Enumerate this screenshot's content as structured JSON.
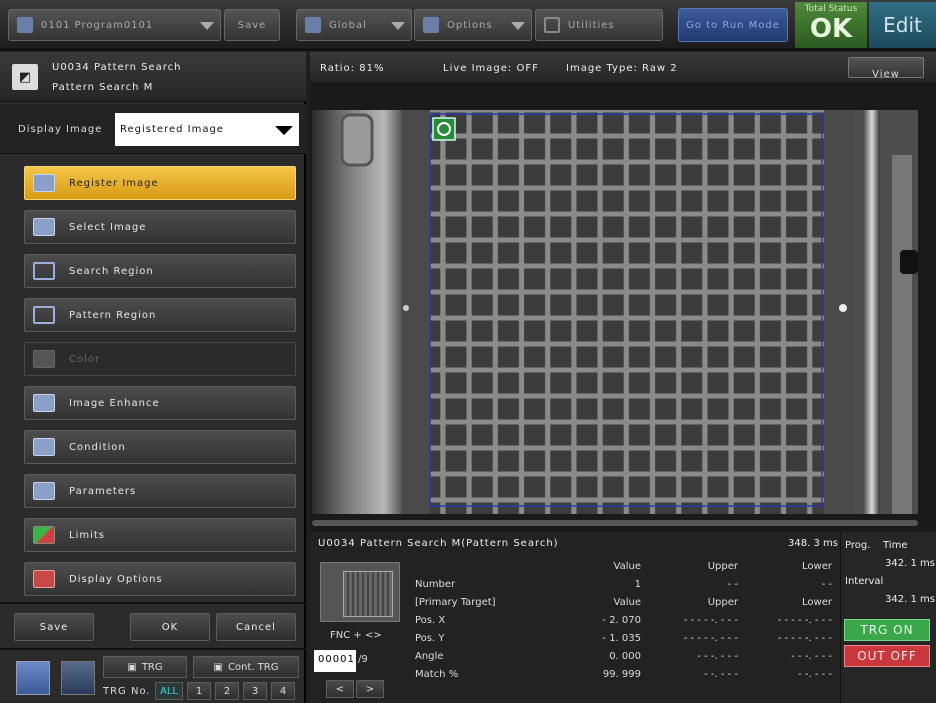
{
  "topbar": {
    "program": "0101 Program0101",
    "save": "Save",
    "global": "Global",
    "options": "Options",
    "utilities": "Utilities",
    "run_mode": "Go to Run Mode",
    "total_status_label": "Total Status",
    "total_status": "OK",
    "edit": "Edit"
  },
  "tool": {
    "id": "U0034 Pattern Search",
    "name": "Pattern Search M"
  },
  "display_image": {
    "label": "Display Image",
    "value": "Registered Image"
  },
  "menu": [
    {
      "label": "Register Image",
      "icon": "register-image-icon",
      "state": "active"
    },
    {
      "label": "Select Image",
      "icon": "select-image-icon",
      "state": "normal"
    },
    {
      "label": "Search Region",
      "icon": "search-region-icon",
      "state": "normal"
    },
    {
      "label": "Pattern Region",
      "icon": "pattern-region-icon",
      "state": "normal"
    },
    {
      "label": "Color",
      "icon": "color-picker-icon",
      "state": "disabled"
    },
    {
      "label": "Image Enhance",
      "icon": "image-enhance-icon",
      "state": "normal"
    },
    {
      "label": "Condition",
      "icon": "condition-icon",
      "state": "normal"
    },
    {
      "label": "Parameters",
      "icon": "parameters-icon",
      "state": "normal"
    },
    {
      "label": "Limits",
      "icon": "ok-ng-icon",
      "state": "normal"
    },
    {
      "label": "Display Options",
      "icon": "display-options-icon",
      "state": "normal"
    }
  ],
  "bottom": {
    "save": "Save",
    "ok": "OK",
    "cancel": "Cancel",
    "trg": "TRG",
    "cont_trg": "Cont. TRG",
    "trg_no": "TRG No.",
    "trg_all": "ALL",
    "trg_nums": [
      "1",
      "2",
      "3",
      "4"
    ]
  },
  "view_info": {
    "ratio": "Ratio: 81%",
    "live": "Live Image: OFF",
    "image_type": "Image Type: Raw 2",
    "view": "View"
  },
  "results": {
    "title": "U0034 Pattern Search M(Pattern Search)",
    "tool_time": "348. 3 ms",
    "prog_label": "Prog.",
    "time_label": "Time",
    "prog_time": "342. 1 ms",
    "interval_label": "Interval",
    "interval": "342. 1 ms",
    "fnc": "FNC + <>",
    "counter": "00001",
    "counter_total": "/9",
    "prev": "<",
    "next": ">",
    "trg_on": "TRG ON",
    "out_off": "OUT OFF",
    "header": {
      "value": "Value",
      "upper": "Upper",
      "lower": "Lower"
    },
    "rows": [
      {
        "name": "Number",
        "value": "1",
        "upper": "- -",
        "lower": "- -"
      },
      {
        "name": "[Primary Target]",
        "value": "Value",
        "upper": "Upper",
        "lower": "Lower"
      },
      {
        "name": "Pos. X",
        "value": "- 2. 070",
        "upper": "- - - - -. - - -",
        "lower": "- - - - -. - - -"
      },
      {
        "name": "Pos. Y",
        "value": "- 1. 035",
        "upper": "- - - - -. - - -",
        "lower": "- - - - -. - - -"
      },
      {
        "name": "Angle",
        "value": "0. 000",
        "upper": "- - -. - - -",
        "lower": "- - -. - - -"
      },
      {
        "name": "Match %",
        "value": "99. 999",
        "upper": "- -. - - -",
        "lower": "- -. - - -"
      }
    ]
  },
  "colors": {
    "active_button": "#e8b22e",
    "status_ok": "#3f7a2e",
    "edit_bg": "#2a6177",
    "run_mode": "#2f4c88",
    "trg_on": "#3aa84a",
    "out_off": "#c8383c",
    "search_region_outline": "#2b3aa8"
  }
}
